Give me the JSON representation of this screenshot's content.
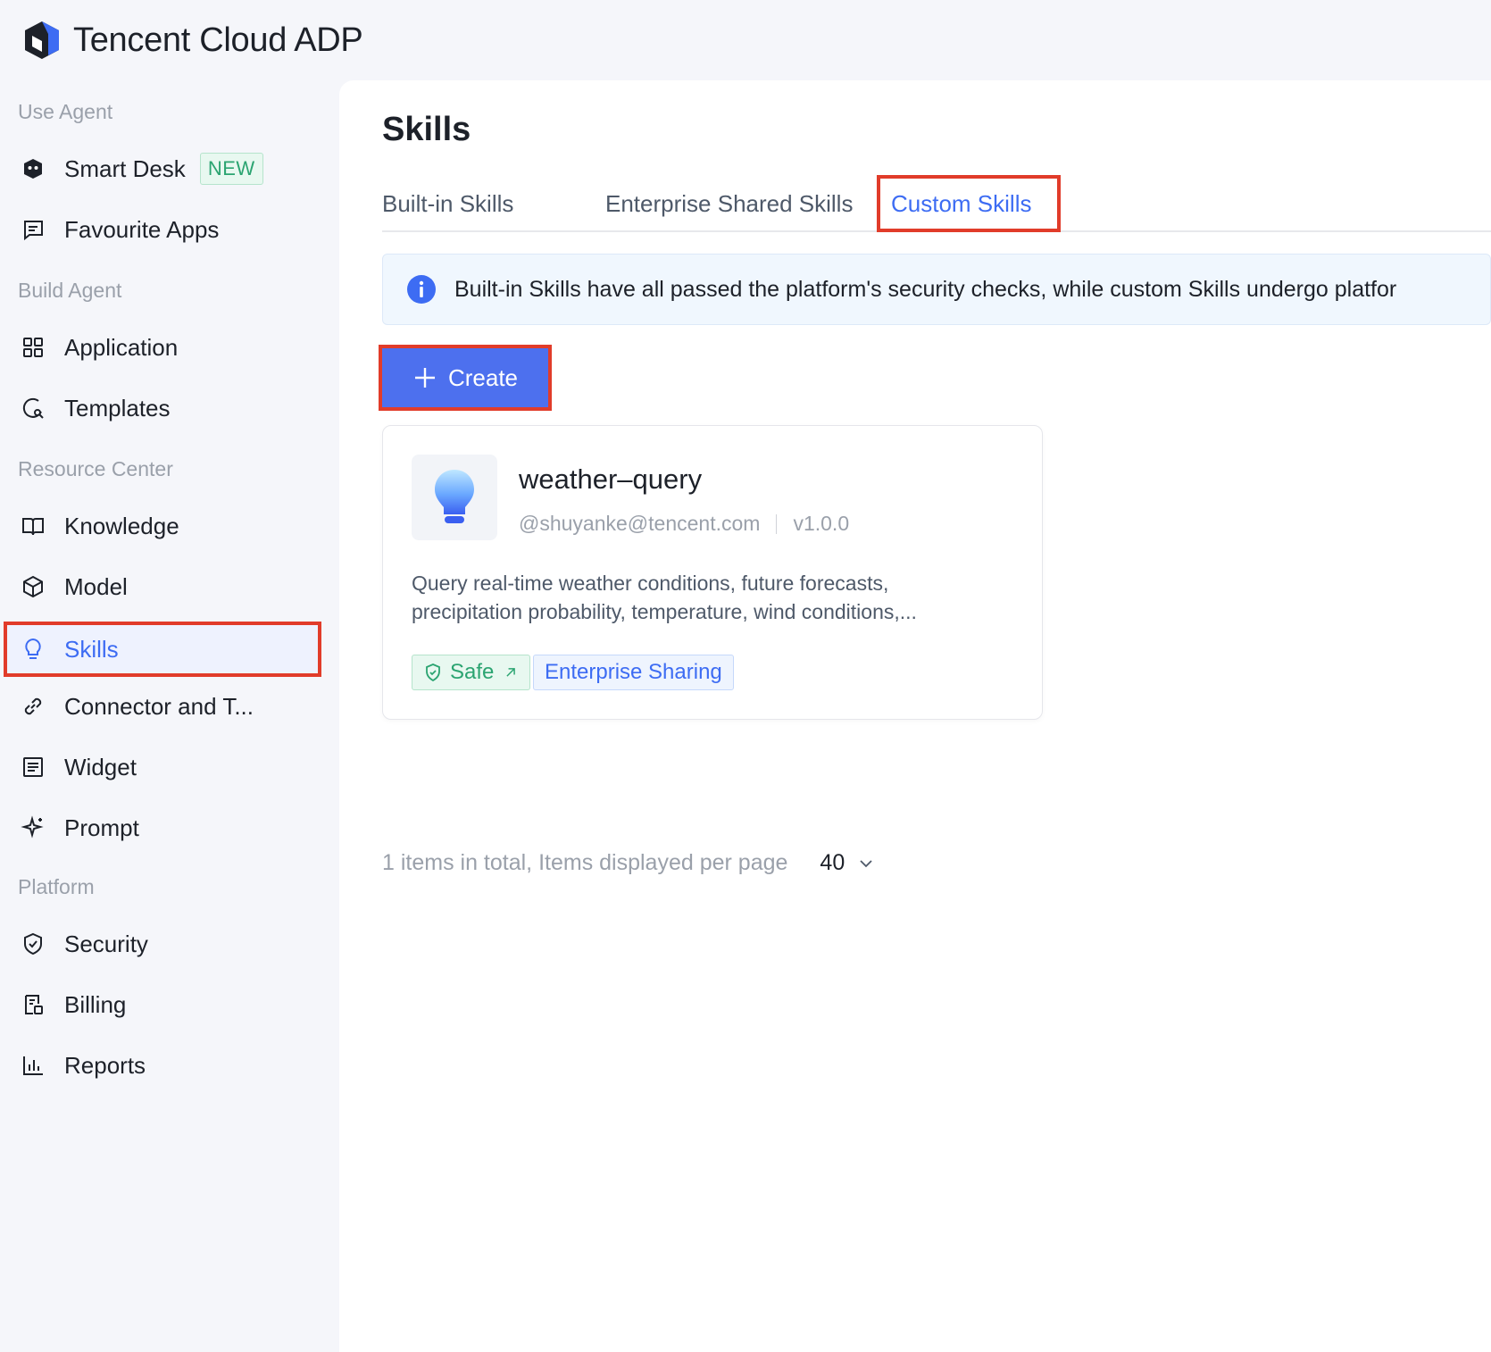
{
  "brand": {
    "name": "Tencent Cloud ADP"
  },
  "sidebar": {
    "sections": [
      {
        "label": "Use Agent"
      },
      {
        "label": "Build Agent"
      },
      {
        "label": "Resource Center"
      },
      {
        "label": "Platform"
      }
    ],
    "items": [
      {
        "label": "Smart Desk",
        "icon": "robot-icon",
        "badge": "NEW"
      },
      {
        "label": "Favourite Apps",
        "icon": "chat-icon"
      },
      {
        "label": "Application",
        "icon": "grid-icon"
      },
      {
        "label": "Templates",
        "icon": "template-icon"
      },
      {
        "label": "Knowledge",
        "icon": "book-icon"
      },
      {
        "label": "Model",
        "icon": "cube-icon"
      },
      {
        "label": "Skills",
        "icon": "bulb-icon",
        "active": true
      },
      {
        "label": "Connector and T...",
        "icon": "link-icon"
      },
      {
        "label": "Widget",
        "icon": "widget-icon"
      },
      {
        "label": "Prompt",
        "icon": "sparkle-icon"
      },
      {
        "label": "Security",
        "icon": "shield-icon"
      },
      {
        "label": "Billing",
        "icon": "billing-icon"
      },
      {
        "label": "Reports",
        "icon": "chart-icon"
      }
    ]
  },
  "main": {
    "title": "Skills",
    "tabs": [
      {
        "label": "Built-in Skills"
      },
      {
        "label": "Enterprise Shared Skills"
      },
      {
        "label": "Custom Skills",
        "active": true
      }
    ],
    "notice": "Built-in Skills have all passed the platform's security checks, while custom Skills undergo platfor",
    "create_label": "Create",
    "card": {
      "title": "weather–query",
      "author": "@shuyanke@tencent.com",
      "version": "v1.0.0",
      "description_line1": "Query real-time weather conditions, future forecasts,",
      "description_line2": "precipitation probability, temperature, wind conditions,...",
      "tag_safe": "Safe",
      "tag_share": "Enterprise Sharing"
    },
    "pager": {
      "summary": "1 items in total, Items displayed per page",
      "page_size": "40"
    }
  },
  "colors": {
    "accent": "#3d6cf3",
    "button": "#4d70ee",
    "highlight": "#e13c2a",
    "safe": "#2ba471"
  }
}
